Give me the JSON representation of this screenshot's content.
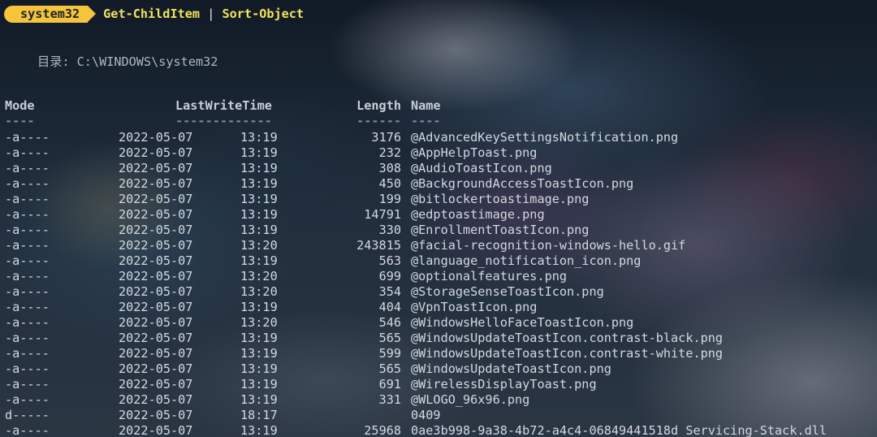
{
  "prompt": {
    "location": "system32",
    "command": "Get-ChildItem",
    "pipe": "|",
    "command2": "Sort-Object"
  },
  "directory_line": "目录: C:\\WINDOWS\\system32",
  "columns": {
    "mode": "Mode",
    "lastwritetime": "LastWriteTime",
    "length": "Length",
    "name": "Name"
  },
  "underlines": {
    "mode": "----",
    "lastwritetime": "-------------",
    "length": "------",
    "name": "----"
  },
  "rows": [
    {
      "mode": "-a----",
      "date": "2022-05-07",
      "time": "13:19",
      "length": "3176",
      "name": "@AdvancedKeySettingsNotification.png"
    },
    {
      "mode": "-a----",
      "date": "2022-05-07",
      "time": "13:19",
      "length": "232",
      "name": "@AppHelpToast.png"
    },
    {
      "mode": "-a----",
      "date": "2022-05-07",
      "time": "13:19",
      "length": "308",
      "name": "@AudioToastIcon.png"
    },
    {
      "mode": "-a----",
      "date": "2022-05-07",
      "time": "13:19",
      "length": "450",
      "name": "@BackgroundAccessToastIcon.png"
    },
    {
      "mode": "-a----",
      "date": "2022-05-07",
      "time": "13:19",
      "length": "199",
      "name": "@bitlockertoastimage.png"
    },
    {
      "mode": "-a----",
      "date": "2022-05-07",
      "time": "13:19",
      "length": "14791",
      "name": "@edptoastimage.png"
    },
    {
      "mode": "-a----",
      "date": "2022-05-07",
      "time": "13:19",
      "length": "330",
      "name": "@EnrollmentToastIcon.png"
    },
    {
      "mode": "-a----",
      "date": "2022-05-07",
      "time": "13:20",
      "length": "243815",
      "name": "@facial-recognition-windows-hello.gif"
    },
    {
      "mode": "-a----",
      "date": "2022-05-07",
      "time": "13:19",
      "length": "563",
      "name": "@language_notification_icon.png"
    },
    {
      "mode": "-a----",
      "date": "2022-05-07",
      "time": "13:20",
      "length": "699",
      "name": "@optionalfeatures.png"
    },
    {
      "mode": "-a----",
      "date": "2022-05-07",
      "time": "13:20",
      "length": "354",
      "name": "@StorageSenseToastIcon.png"
    },
    {
      "mode": "-a----",
      "date": "2022-05-07",
      "time": "13:19",
      "length": "404",
      "name": "@VpnToastIcon.png"
    },
    {
      "mode": "-a----",
      "date": "2022-05-07",
      "time": "13:20",
      "length": "546",
      "name": "@WindowsHelloFaceToastIcon.png"
    },
    {
      "mode": "-a----",
      "date": "2022-05-07",
      "time": "13:19",
      "length": "565",
      "name": "@WindowsUpdateToastIcon.contrast-black.png"
    },
    {
      "mode": "-a----",
      "date": "2022-05-07",
      "time": "13:19",
      "length": "599",
      "name": "@WindowsUpdateToastIcon.contrast-white.png"
    },
    {
      "mode": "-a----",
      "date": "2022-05-07",
      "time": "13:19",
      "length": "565",
      "name": "@WindowsUpdateToastIcon.png"
    },
    {
      "mode": "-a----",
      "date": "2022-05-07",
      "time": "13:19",
      "length": "691",
      "name": "@WirelessDisplayToast.png"
    },
    {
      "mode": "-a----",
      "date": "2022-05-07",
      "time": "13:19",
      "length": "331",
      "name": "@WLOGO_96x96.png"
    },
    {
      "mode": "d-----",
      "date": "2022-05-07",
      "time": "18:17",
      "length": "",
      "name": "0409"
    },
    {
      "mode": "-a----",
      "date": "2022-05-07",
      "time": "13:19",
      "length": "25968",
      "name": "0ae3b998-9a38-4b72-a4c4-06849441518d_Servicing-Stack.dll"
    }
  ],
  "colors": {
    "prompt_segment": "#f5c43b",
    "command": "#f2e25c",
    "text": "#d4d8e0"
  }
}
